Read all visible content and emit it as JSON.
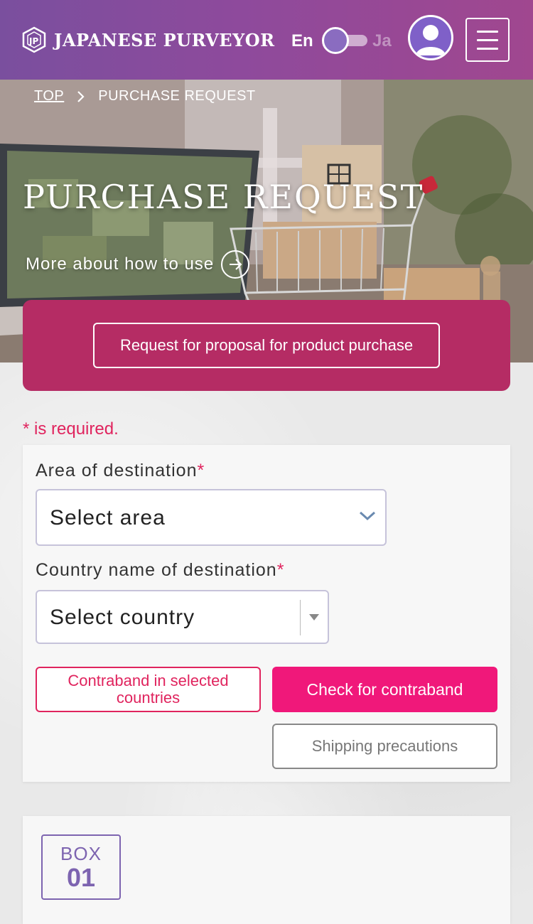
{
  "header": {
    "logo_text": "JAPANESE PURVEYOR",
    "lang_en": "En",
    "lang_ja": "Ja",
    "colors": {
      "gradient_start": "#7a4f9e",
      "gradient_end": "#a0478f"
    }
  },
  "breadcrumb": {
    "top": "TOP",
    "current": "PURCHASE REQUEST"
  },
  "hero": {
    "title": "PURCHASE REQUEST",
    "more_link": "More about how to use"
  },
  "panel": {
    "proposal_button": "Request for proposal for product purchase",
    "color": "#b52c64"
  },
  "form": {
    "required_note": "* is required.",
    "area_label": "Area of destination",
    "area_placeholder": "Select area",
    "country_label": "Country name of destination",
    "country_placeholder": "Select country",
    "required_mark": "*",
    "contraband_list_button": "Contraband in selected countries",
    "check_contraband_button": "Check for contraband",
    "shipping_precautions_button": "Shipping precautions",
    "accent_color": "#f0187a"
  },
  "box": {
    "label": "BOX",
    "number": "01"
  }
}
